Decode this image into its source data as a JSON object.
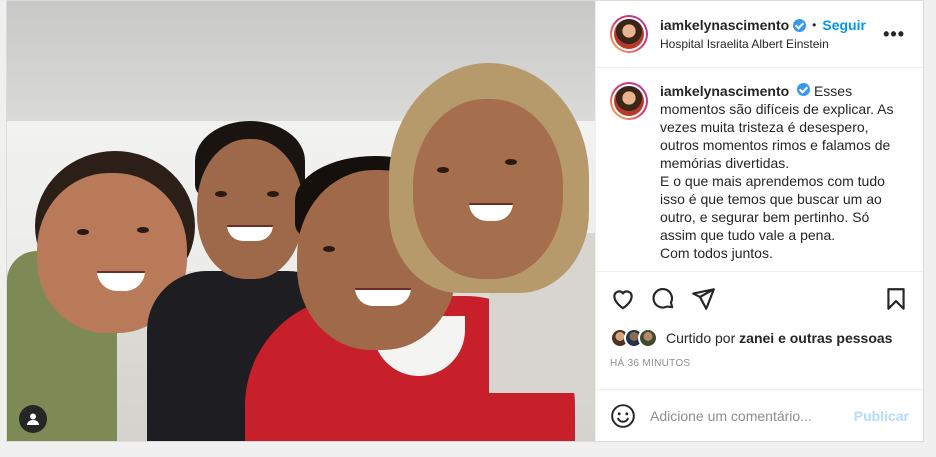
{
  "post": {
    "username": "iamkelynascimento",
    "follow_label": "Seguir",
    "separator": "•",
    "location": "Hospital Israelita Albert Einstein",
    "more_label": "•••",
    "caption_lines": [
      "Esses",
      "momentos são difíceis de explicar. As",
      "vezes muita tristeza é desespero,",
      "outros momentos rimos e falamos de",
      "memórias divertidas.",
      "E o que mais aprendemos com tudo",
      "isso é que temos que buscar um ao",
      "outro, e segurar bem pertinho. Só",
      "assim que tudo vale a pena.",
      "Com todos juntos."
    ],
    "likes": {
      "prefix": "Curtido por",
      "user": "zanei",
      "connector": "e",
      "others": "outras pessoas"
    },
    "time": "HÁ 36 MINUTOS",
    "comment_placeholder": "Adicione um comentário...",
    "publish_label": "Publicar"
  },
  "icons": {
    "like": "heart-icon",
    "comment": "comment-icon",
    "share": "share-icon",
    "save": "bookmark-icon",
    "emoji": "emoji-icon",
    "tag": "user-tag-icon",
    "verified": "verified-badge-icon"
  },
  "colors": {
    "link_blue": "#0095f6",
    "verified_blue": "#3897f0",
    "publish_disabled": "#b3dbff",
    "hoodie_red": "#c8202a"
  }
}
